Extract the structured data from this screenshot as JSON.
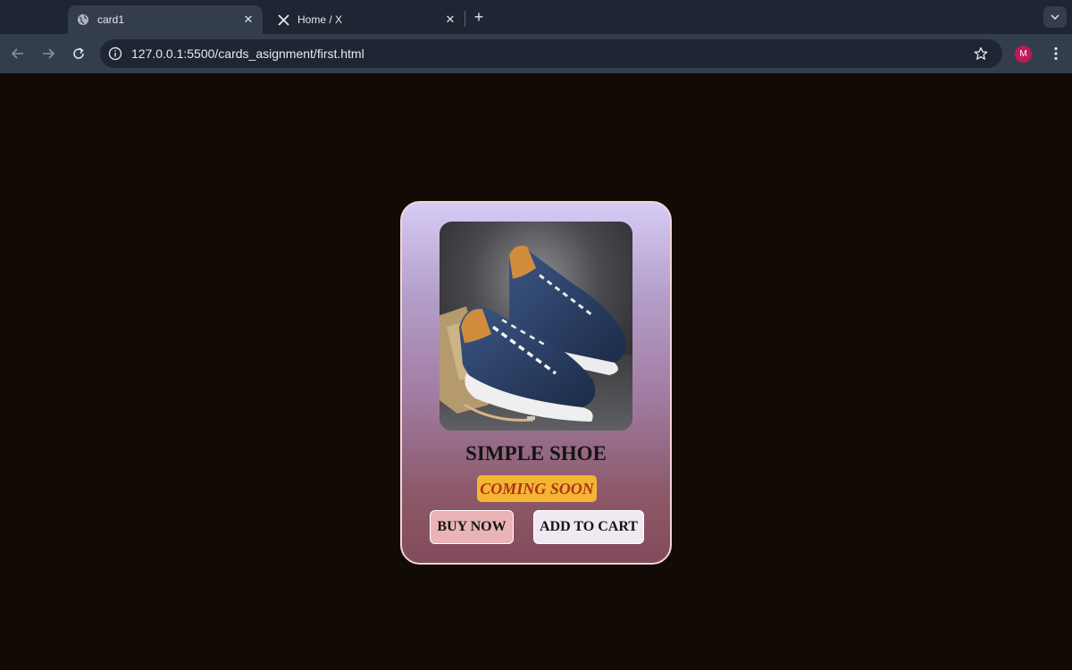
{
  "browser": {
    "tabs": [
      {
        "title": "card1",
        "active": true,
        "icon": "globe-icon"
      },
      {
        "title": "Home / X",
        "active": false,
        "icon": "x-logo-icon"
      }
    ],
    "url": "127.0.0.1:5500/cards_asignment/first.html",
    "profile_initial": "M"
  },
  "card": {
    "image_subject": "navy blue sneakers with orange collars",
    "title": "SIMPLE SHOE",
    "badge": "COMING SOON",
    "buy_label": "BUY NOW",
    "cart_label": "ADD TO CART"
  },
  "colors": {
    "page_background": "#120a05",
    "card_gradient_top": "#d7cbf5",
    "card_gradient_bottom": "#834b5b",
    "badge_background": "#f3b632",
    "badge_text": "#b23020",
    "buy_button": "#e9b3b8",
    "cart_button": "#efeaf2"
  }
}
